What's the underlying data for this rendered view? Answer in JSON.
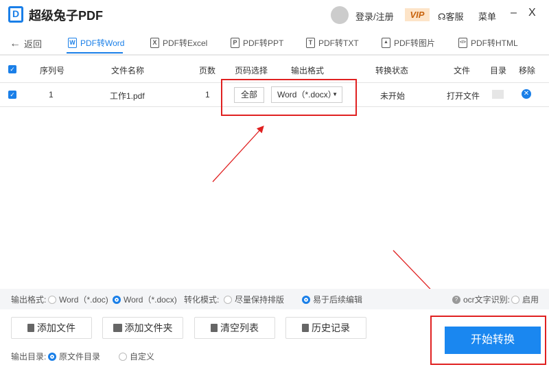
{
  "app": {
    "title": "超级兔子PDF",
    "logo": "D",
    "login": "登录/注册",
    "vip": "VIP",
    "service": "客服",
    "menu": "菜单",
    "minimize": "–",
    "close": "X"
  },
  "nav": {
    "back": "返回",
    "tabs": [
      {
        "icon": "W",
        "label": "PDF转Word"
      },
      {
        "icon": "X",
        "label": "PDF转Excel"
      },
      {
        "icon": "P",
        "label": "PDF转PPT"
      },
      {
        "icon": "T",
        "label": "PDF转TXT"
      },
      {
        "icon": "▲",
        "label": "PDF转图片"
      },
      {
        "icon": "</>",
        "label": "PDF转HTML"
      }
    ]
  },
  "table": {
    "headers": [
      "序列号",
      "文件名称",
      "页数",
      "页码选择",
      "输出格式",
      "转换状态",
      "文件",
      "目录",
      "移除"
    ],
    "rows": [
      {
        "index": "1",
        "name": "工作1.pdf",
        "pages": "1",
        "page_select": "全部",
        "format": "Word（*.docx）",
        "status": "未开始",
        "open": "打开文件"
      }
    ]
  },
  "options": {
    "format_label": "输出格式:",
    "format_doc": "Word（*.doc)",
    "format_docx": "Word（*.docx)",
    "mode_label": "转化模式:",
    "mode_layout": "尽量保持排版",
    "mode_edit": "易于后续编辑",
    "ocr_label": "ocr文字识别:",
    "ocr_enable": "启用"
  },
  "actions": {
    "add_file": "添加文件",
    "add_folder": "添加文件夹",
    "clear": "清空列表",
    "history": "历史记录",
    "start": "开始转换"
  },
  "output_dir": {
    "label": "输出目录:",
    "original": "原文件目录",
    "custom": "自定义"
  },
  "colors": {
    "accent": "#1a7fe8",
    "highlight": "#e02020"
  }
}
